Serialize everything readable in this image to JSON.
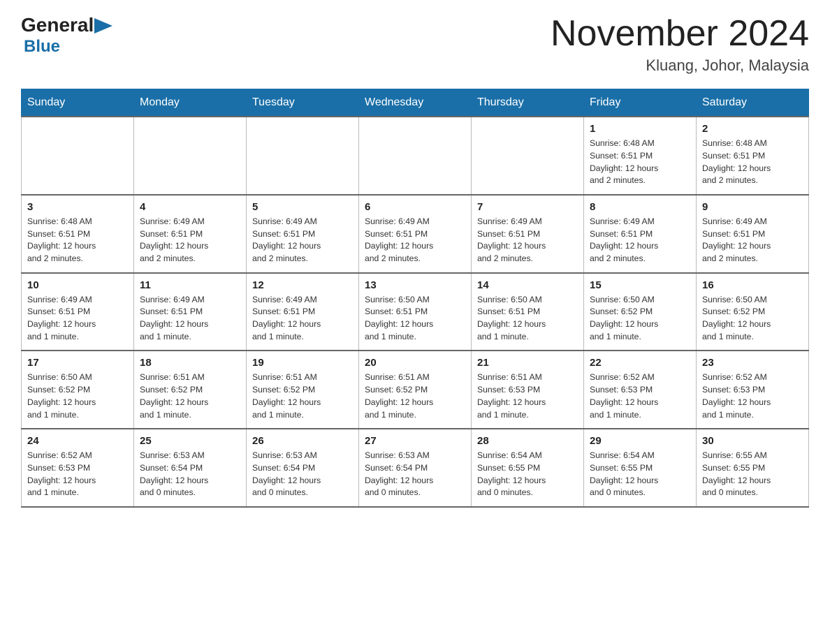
{
  "header": {
    "month_year": "November 2024",
    "location": "Kluang, Johor, Malaysia",
    "logo_general": "General",
    "logo_blue": "Blue"
  },
  "days_of_week": [
    "Sunday",
    "Monday",
    "Tuesday",
    "Wednesday",
    "Thursday",
    "Friday",
    "Saturday"
  ],
  "weeks": [
    [
      {
        "day": "",
        "info": ""
      },
      {
        "day": "",
        "info": ""
      },
      {
        "day": "",
        "info": ""
      },
      {
        "day": "",
        "info": ""
      },
      {
        "day": "",
        "info": ""
      },
      {
        "day": "1",
        "info": "Sunrise: 6:48 AM\nSunset: 6:51 PM\nDaylight: 12 hours\nand 2 minutes."
      },
      {
        "day": "2",
        "info": "Sunrise: 6:48 AM\nSunset: 6:51 PM\nDaylight: 12 hours\nand 2 minutes."
      }
    ],
    [
      {
        "day": "3",
        "info": "Sunrise: 6:48 AM\nSunset: 6:51 PM\nDaylight: 12 hours\nand 2 minutes."
      },
      {
        "day": "4",
        "info": "Sunrise: 6:49 AM\nSunset: 6:51 PM\nDaylight: 12 hours\nand 2 minutes."
      },
      {
        "day": "5",
        "info": "Sunrise: 6:49 AM\nSunset: 6:51 PM\nDaylight: 12 hours\nand 2 minutes."
      },
      {
        "day": "6",
        "info": "Sunrise: 6:49 AM\nSunset: 6:51 PM\nDaylight: 12 hours\nand 2 minutes."
      },
      {
        "day": "7",
        "info": "Sunrise: 6:49 AM\nSunset: 6:51 PM\nDaylight: 12 hours\nand 2 minutes."
      },
      {
        "day": "8",
        "info": "Sunrise: 6:49 AM\nSunset: 6:51 PM\nDaylight: 12 hours\nand 2 minutes."
      },
      {
        "day": "9",
        "info": "Sunrise: 6:49 AM\nSunset: 6:51 PM\nDaylight: 12 hours\nand 2 minutes."
      }
    ],
    [
      {
        "day": "10",
        "info": "Sunrise: 6:49 AM\nSunset: 6:51 PM\nDaylight: 12 hours\nand 1 minute."
      },
      {
        "day": "11",
        "info": "Sunrise: 6:49 AM\nSunset: 6:51 PM\nDaylight: 12 hours\nand 1 minute."
      },
      {
        "day": "12",
        "info": "Sunrise: 6:49 AM\nSunset: 6:51 PM\nDaylight: 12 hours\nand 1 minute."
      },
      {
        "day": "13",
        "info": "Sunrise: 6:50 AM\nSunset: 6:51 PM\nDaylight: 12 hours\nand 1 minute."
      },
      {
        "day": "14",
        "info": "Sunrise: 6:50 AM\nSunset: 6:51 PM\nDaylight: 12 hours\nand 1 minute."
      },
      {
        "day": "15",
        "info": "Sunrise: 6:50 AM\nSunset: 6:52 PM\nDaylight: 12 hours\nand 1 minute."
      },
      {
        "day": "16",
        "info": "Sunrise: 6:50 AM\nSunset: 6:52 PM\nDaylight: 12 hours\nand 1 minute."
      }
    ],
    [
      {
        "day": "17",
        "info": "Sunrise: 6:50 AM\nSunset: 6:52 PM\nDaylight: 12 hours\nand 1 minute."
      },
      {
        "day": "18",
        "info": "Sunrise: 6:51 AM\nSunset: 6:52 PM\nDaylight: 12 hours\nand 1 minute."
      },
      {
        "day": "19",
        "info": "Sunrise: 6:51 AM\nSunset: 6:52 PM\nDaylight: 12 hours\nand 1 minute."
      },
      {
        "day": "20",
        "info": "Sunrise: 6:51 AM\nSunset: 6:52 PM\nDaylight: 12 hours\nand 1 minute."
      },
      {
        "day": "21",
        "info": "Sunrise: 6:51 AM\nSunset: 6:53 PM\nDaylight: 12 hours\nand 1 minute."
      },
      {
        "day": "22",
        "info": "Sunrise: 6:52 AM\nSunset: 6:53 PM\nDaylight: 12 hours\nand 1 minute."
      },
      {
        "day": "23",
        "info": "Sunrise: 6:52 AM\nSunset: 6:53 PM\nDaylight: 12 hours\nand 1 minute."
      }
    ],
    [
      {
        "day": "24",
        "info": "Sunrise: 6:52 AM\nSunset: 6:53 PM\nDaylight: 12 hours\nand 1 minute."
      },
      {
        "day": "25",
        "info": "Sunrise: 6:53 AM\nSunset: 6:54 PM\nDaylight: 12 hours\nand 0 minutes."
      },
      {
        "day": "26",
        "info": "Sunrise: 6:53 AM\nSunset: 6:54 PM\nDaylight: 12 hours\nand 0 minutes."
      },
      {
        "day": "27",
        "info": "Sunrise: 6:53 AM\nSunset: 6:54 PM\nDaylight: 12 hours\nand 0 minutes."
      },
      {
        "day": "28",
        "info": "Sunrise: 6:54 AM\nSunset: 6:55 PM\nDaylight: 12 hours\nand 0 minutes."
      },
      {
        "day": "29",
        "info": "Sunrise: 6:54 AM\nSunset: 6:55 PM\nDaylight: 12 hours\nand 0 minutes."
      },
      {
        "day": "30",
        "info": "Sunrise: 6:55 AM\nSunset: 6:55 PM\nDaylight: 12 hours\nand 0 minutes."
      }
    ]
  ]
}
